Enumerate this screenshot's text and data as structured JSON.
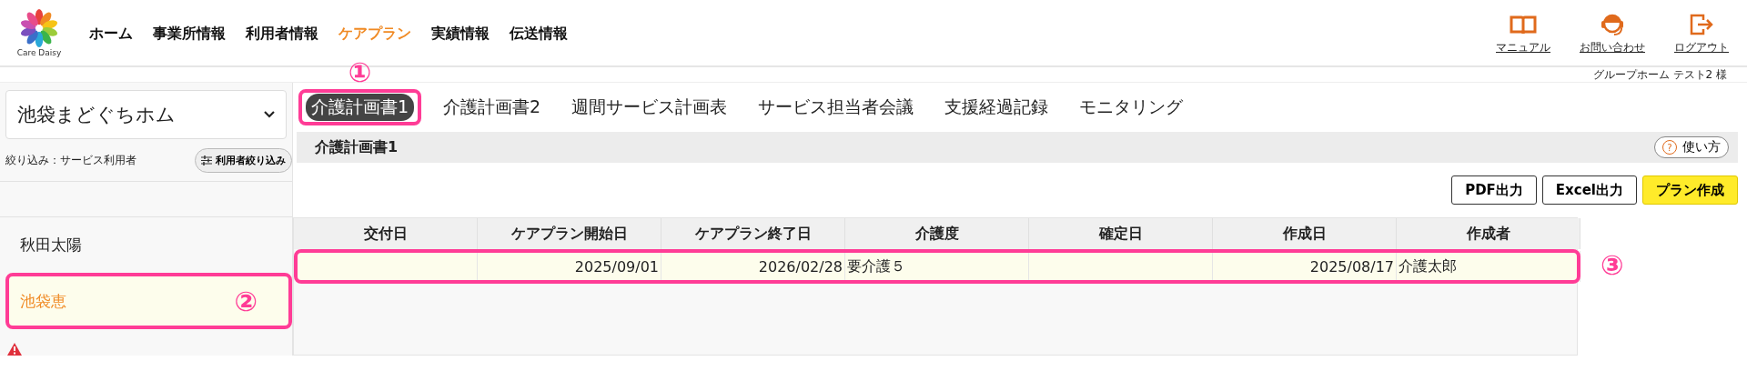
{
  "header": {
    "logo_text": "Care Daisy",
    "nav": [
      {
        "label": "ホーム",
        "selected": false
      },
      {
        "label": "事業所情報",
        "selected": false
      },
      {
        "label": "利用者情報",
        "selected": false
      },
      {
        "label": "ケアプラン",
        "selected": true
      },
      {
        "label": "実績情報",
        "selected": false
      },
      {
        "label": "伝送情報",
        "selected": false
      }
    ],
    "links": [
      {
        "kind": "manual",
        "label": "マニュアル"
      },
      {
        "kind": "contact",
        "label": "お問い合わせ"
      },
      {
        "kind": "logout",
        "label": "ログアウト"
      }
    ],
    "account": "グループホーム テスト2 様"
  },
  "sidebar": {
    "office_select": "池袋まどぐちホム",
    "filter_label": "絞り込み：サービス利用者",
    "filter_button": "利用者絞り込み",
    "users": [
      {
        "name": "秋田太陽",
        "selected": false
      },
      {
        "name": "池袋恵",
        "selected": true,
        "callout": "②"
      }
    ]
  },
  "tabs": [
    {
      "label": "介護計画書1",
      "selected": true,
      "callout": "①"
    },
    {
      "label": "介護計画書2",
      "selected": false
    },
    {
      "label": "週間サービス計画表",
      "selected": false
    },
    {
      "label": "サービス担当者会議",
      "selected": false
    },
    {
      "label": "支援経過記録",
      "selected": false
    },
    {
      "label": "モニタリング",
      "selected": false
    }
  ],
  "panel": {
    "title": "介護計画書1",
    "help_button": "使い方",
    "help_icon": "?",
    "actions": [
      {
        "label": "PDF出力",
        "kind": "plain"
      },
      {
        "label": "Excel出力",
        "kind": "plain"
      },
      {
        "label": "プラン作成",
        "kind": "primary"
      }
    ]
  },
  "table": {
    "columns": [
      "交付日",
      "ケアプラン開始日",
      "ケアプラン終了日",
      "介護度",
      "確定日",
      "作成日",
      "作成者"
    ],
    "rows": [
      {
        "cells": [
          "",
          "2025/09/01",
          "2026/02/28",
          "要介護５",
          "",
          "2025/08/17",
          "介護太郎"
        ],
        "selected": true,
        "callout": "③"
      }
    ]
  }
}
